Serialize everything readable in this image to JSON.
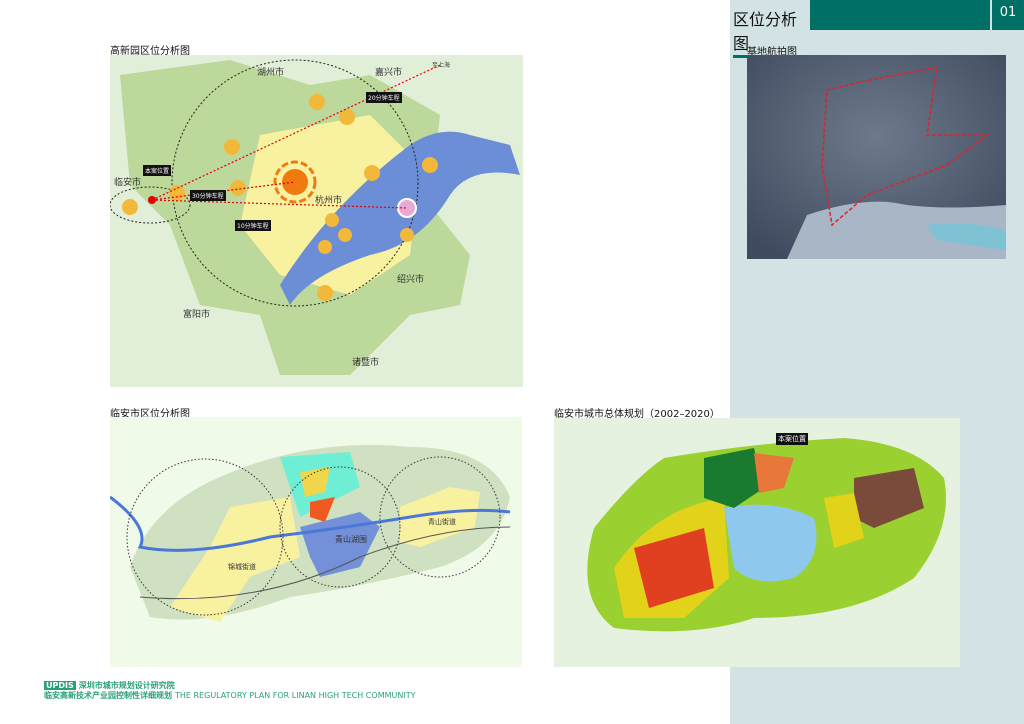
{
  "header": {
    "title": "区位分析图",
    "page_number": "01"
  },
  "aerial": {
    "caption": "基地航拍图"
  },
  "map_high_tech": {
    "caption": "高新园区位分析图",
    "cities": [
      "湖州市",
      "嘉兴市",
      "临安市",
      "杭州市",
      "富阳市",
      "诸暨市",
      "绍兴市"
    ],
    "tags": [
      "30分钟车程",
      "20分钟车程",
      "本案位置",
      "10分钟车程",
      "至上海"
    ]
  },
  "map_linan": {
    "caption": "临安市区位分析图",
    "places": [
      "锦城街道",
      "青山湖围",
      "青山街道"
    ]
  },
  "map_master": {
    "caption": "临安市城市总体规划（2002–2020）",
    "tag": "本案位置"
  },
  "footer": {
    "badge": "UPDIS",
    "institute": "深圳市城市规划设计研究院",
    "project_cn": "临安高新技术产业园控制性详细规划",
    "project_en": "THE REGULATORY PLAN FOR LINAN HIGH TECH COMMUNITY"
  }
}
